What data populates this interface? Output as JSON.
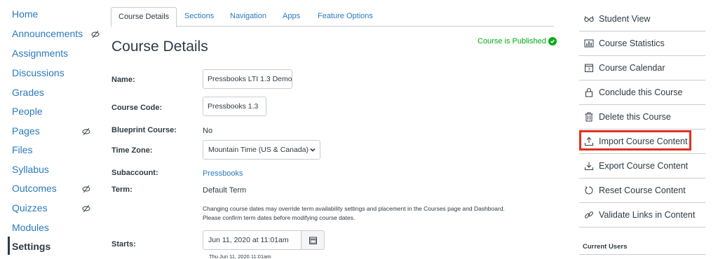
{
  "nav": {
    "items": [
      {
        "label": "Home"
      },
      {
        "label": "Announcements"
      },
      {
        "label": "Assignments"
      },
      {
        "label": "Discussions"
      },
      {
        "label": "Grades"
      },
      {
        "label": "People"
      },
      {
        "label": "Pages"
      },
      {
        "label": "Files"
      },
      {
        "label": "Syllabus"
      },
      {
        "label": "Outcomes"
      },
      {
        "label": "Quizzes"
      },
      {
        "label": "Modules"
      },
      {
        "label": "Settings"
      }
    ]
  },
  "tabs": [
    {
      "label": "Course Details"
    },
    {
      "label": "Sections"
    },
    {
      "label": "Navigation"
    },
    {
      "label": "Apps"
    },
    {
      "label": "Feature Options"
    }
  ],
  "main": {
    "title": "Course Details",
    "published": "Course is Published",
    "name_label": "Name:",
    "name_value": "Pressbooks LTI 1.3 Demo",
    "code_label": "Course Code:",
    "code_value": "Pressbooks 1.3",
    "blueprint_label": "Blueprint Course:",
    "blueprint_value": "No",
    "timezone_label": "Time Zone:",
    "timezone_value": "Mountain Time (US & Canada)",
    "subaccount_label": "Subaccount:",
    "subaccount_value": "Pressbooks",
    "term_label": "Term:",
    "term_value": "Default Term",
    "note_line1": "Changing course dates may override term availability settings and placement in the Courses page and Dashboard.",
    "note_line2": "Please confirm term dates before modifying course dates.",
    "starts_label": "Starts:",
    "starts_value": "Jun 11, 2020 at 11:01am",
    "starts_hint": "Thu Jun 11, 2020 11:01am"
  },
  "sidebar": {
    "buttons": [
      {
        "label": "Student View",
        "icon": "glasses-icon"
      },
      {
        "label": "Course Statistics",
        "icon": "bar-chart-icon"
      },
      {
        "label": "Course Calendar",
        "icon": "calendar-icon"
      },
      {
        "label": "Conclude this Course",
        "icon": "lock-icon"
      },
      {
        "label": "Delete this Course",
        "icon": "trash-icon"
      },
      {
        "label": "Import Course Content",
        "icon": "upload-icon"
      },
      {
        "label": "Export Course Content",
        "icon": "download-icon"
      },
      {
        "label": "Reset Course Content",
        "icon": "reset-icon"
      },
      {
        "label": "Validate Links in Content",
        "icon": "link-icon"
      }
    ],
    "current_users": "Current Users"
  },
  "colors": {
    "link": "#2b7abc",
    "published": "#00ac18",
    "highlight": "#e0301e",
    "text": "#2d3b45"
  }
}
